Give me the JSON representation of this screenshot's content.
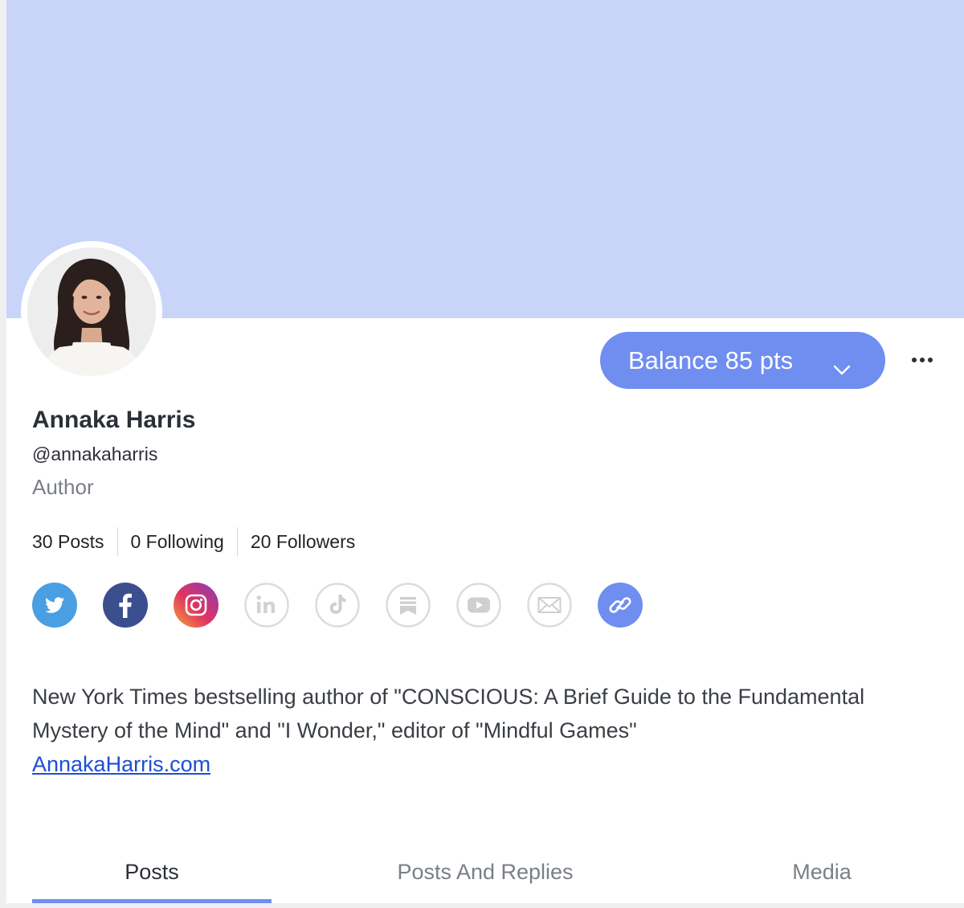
{
  "profile": {
    "name": "Annaka Harris",
    "handle": "@annakaharris",
    "role": "Author"
  },
  "actions": {
    "balance_label": "Balance 85 pts"
  },
  "stats": {
    "posts": "30 Posts",
    "following": "0 Following",
    "followers": "20 Followers"
  },
  "social": [
    {
      "icon": "twitter-icon",
      "active": true,
      "color": "#4a9fe3"
    },
    {
      "icon": "facebook-icon",
      "active": true,
      "color": "#3b4f8f"
    },
    {
      "icon": "instagram-icon",
      "active": true,
      "color": "#d63a6b"
    },
    {
      "icon": "linkedin-icon",
      "active": false,
      "color": "#d7d7d7"
    },
    {
      "icon": "tiktok-icon",
      "active": false,
      "color": "#d7d7d7"
    },
    {
      "icon": "bookmark-icon",
      "active": false,
      "color": "#d7d7d7"
    },
    {
      "icon": "youtube-icon",
      "active": false,
      "color": "#d7d7d7"
    },
    {
      "icon": "email-icon",
      "active": false,
      "color": "#d7d7d7"
    },
    {
      "icon": "link-icon",
      "active": true,
      "color": "#6f8ef0"
    }
  ],
  "bio": {
    "text": "New York Times bestselling author of \"CONSCIOUS: A Brief Guide to the Fundamental Mystery of the Mind\" and \"I Wonder,\" editor of \"Mindful Games\"",
    "link": "AnnakaHarris.com"
  },
  "tabs": [
    {
      "label": "Posts",
      "active": true
    },
    {
      "label": "Posts And Replies",
      "active": false
    },
    {
      "label": "Media",
      "active": false
    }
  ],
  "colors": {
    "banner": "#c9d4f9",
    "accent": "#6f8ef0"
  }
}
